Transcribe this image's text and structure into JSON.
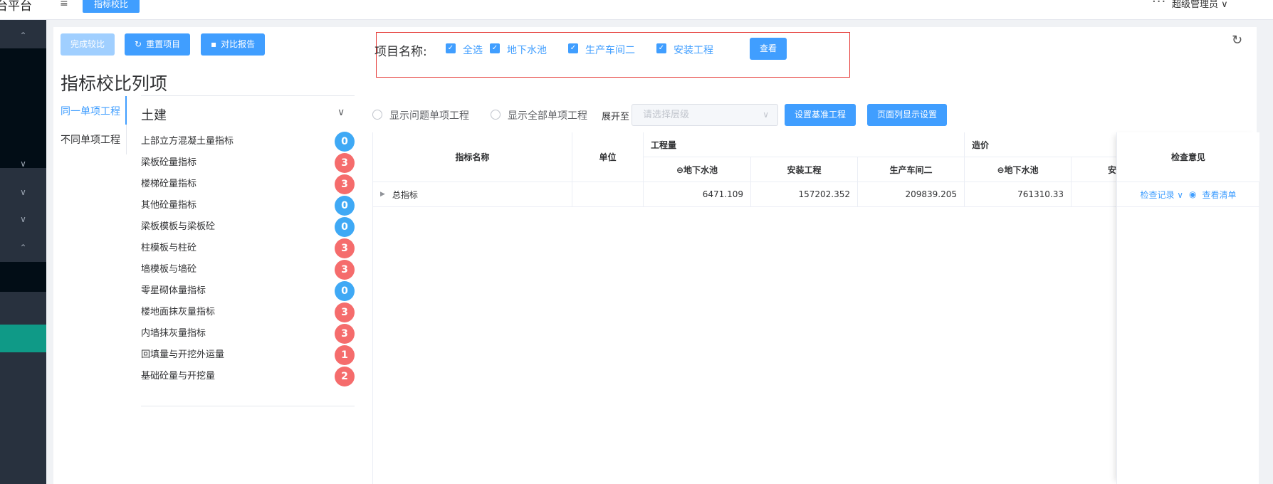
{
  "topbar": {
    "brand": "台平台",
    "hamburger_icon": "menu-icon",
    "active_tab": "指标校比",
    "more_icon": "more-dots-icon",
    "user": "超级管理员 ∨"
  },
  "sidebar": {
    "items": [
      "⌃",
      "∨",
      "∨",
      "∨",
      "⌃"
    ]
  },
  "toolbar": {
    "finish_compare": "完成较比",
    "reset_project": "重置项目",
    "compare_report": "对比报告"
  },
  "left_panel": {
    "title": "指标校比列项",
    "tabs": [
      "同一单项工程",
      "不同单项工程"
    ],
    "group_title": "土建",
    "items": [
      {
        "label": "上部立方混凝土量指标",
        "count": "0",
        "status": "blue"
      },
      {
        "label": "梁板砼量指标",
        "count": "3",
        "status": "red"
      },
      {
        "label": "楼梯砼量指标",
        "count": "3",
        "status": "red"
      },
      {
        "label": "其他砼量指标",
        "count": "0",
        "status": "blue"
      },
      {
        "label": "梁板模板与梁板砼",
        "count": "0",
        "status": "blue"
      },
      {
        "label": "柱模板与柱砼",
        "count": "3",
        "status": "red"
      },
      {
        "label": "墙模板与墙砼",
        "count": "3",
        "status": "red"
      },
      {
        "label": "零星砌体量指标",
        "count": "0",
        "status": "blue"
      },
      {
        "label": "楼地面抹灰量指标",
        "count": "3",
        "status": "red"
      },
      {
        "label": "内墙抹灰量指标",
        "count": "3",
        "status": "red"
      },
      {
        "label": "回填量与开挖外运量",
        "count": "1",
        "status": "red"
      },
      {
        "label": "基础砼量与开挖量",
        "count": "2",
        "status": "red"
      }
    ]
  },
  "filter": {
    "label": "项目名称:",
    "options": [
      "全选",
      "地下水池",
      "生产车间二",
      "安装工程"
    ],
    "view_button": "查看"
  },
  "options_bar": {
    "radio1": "显示问题单项工程",
    "radio2": "显示全部单项工程",
    "expand_label": "展开至",
    "select_placeholder": "请选择层级",
    "set_base": "设置基准工程",
    "column_settings": "页面列显示设置"
  },
  "table": {
    "headers": {
      "name": "指标名称",
      "unit": "单位",
      "quantity": "工程量",
      "cost": "造价",
      "check": "检查意见"
    },
    "quantity_cols": [
      "⊖地下水池",
      "安装工程",
      "生产车间二"
    ],
    "cost_cols": [
      "⊖地下水池",
      "安"
    ],
    "rows": [
      {
        "name": "总指标",
        "unit": "",
        "q1": "6471.109",
        "q2": "157202.352",
        "q3": "209839.205",
        "c1": "761310.33",
        "c2": ""
      }
    ],
    "actions": {
      "check_record": "检查记录 ∨",
      "view_list": "查看清单"
    }
  },
  "colors": {
    "primary": "#409eff",
    "badge_red": "#f56c6c",
    "badge_blue": "#3fa9f5",
    "sidebar": "#28313e",
    "sidebar_active": "#0f9a87",
    "highlight_box": "#e53935"
  }
}
